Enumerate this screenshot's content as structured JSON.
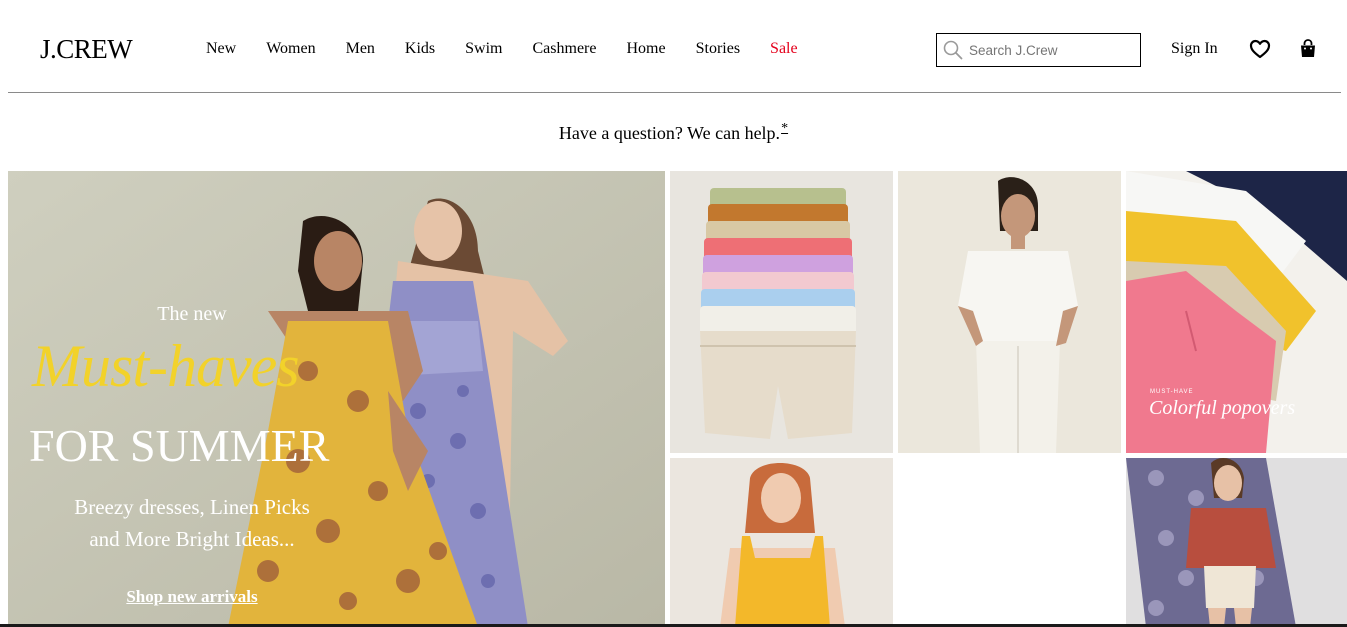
{
  "brand": {
    "logo": "J.CREW"
  },
  "nav": {
    "items": [
      "New",
      "Women",
      "Men",
      "Kids",
      "Swim",
      "Cashmere",
      "Home",
      "Stories"
    ],
    "sale": "Sale",
    "sale_color": "#e4001b"
  },
  "search": {
    "placeholder": "Search J.Crew",
    "value": ""
  },
  "account": {
    "signin": "Sign In",
    "wishlist_icon": "heart-icon",
    "bag_icon": "shopping-bag-icon"
  },
  "help": {
    "text": "Have a question? We can help.",
    "star": "*"
  },
  "hero": {
    "kicker": "The new",
    "script": "Must-haves",
    "headline": "FOR SUMMER",
    "sub_line1": "Breezy dresses, Linen Picks",
    "sub_line2": "and More Bright Ideas...",
    "cta": "Shop new arrivals",
    "script_color": "#f2d22a"
  },
  "tiles": {
    "tops_small": "MUST-HAVE",
    "tops_label": "Colorful popovers"
  }
}
